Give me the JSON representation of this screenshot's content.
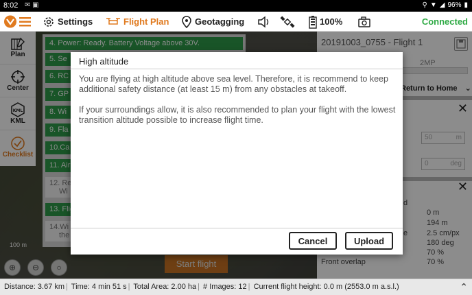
{
  "status_bar": {
    "time": "8:02",
    "battery": "96%"
  },
  "toolbar": {
    "settings_label": "Settings",
    "flight_plan_label": "Flight Plan",
    "geotagging_label": "Geotagging",
    "battery_label": "100%",
    "connection_status": "Connected",
    "accent_color": "#e07a1f",
    "connected_color": "#2eaa44"
  },
  "left_panel": {
    "items": [
      {
        "label": "Plan",
        "icon": "plan-icon"
      },
      {
        "label": "Center",
        "icon": "crosshair-icon"
      },
      {
        "label": "KML",
        "icon": "kml-icon"
      },
      {
        "label": "Checklist",
        "icon": "check-circle-icon"
      }
    ]
  },
  "checklist": {
    "items": [
      "4. Power: Ready. Battery Voltage above 30V.",
      "5. Se",
      "6. RC",
      "7. GP",
      "8. Wi",
      "9. Fla",
      "10.Ca",
      "11. Air",
      "12. Re",
      "13. Flig",
      "14.Wi"
    ],
    "gray_sublines": {
      "12": "Wi",
      "14": "the"
    }
  },
  "right_panel": {
    "title": "20191003_0755 - Flight 1",
    "camera": "2MP",
    "progress": "0%",
    "return_mode": "Return to Home",
    "input1_value": "50",
    "input1_unit": "m",
    "input2_value": "0",
    "input2_unit": "deg",
    "field_cut": "d",
    "values": [
      {
        "label": "",
        "value": "0 m"
      },
      {
        "label": "",
        "value": "194 m"
      },
      {
        "label": "e",
        "value": "2.5 cm/px"
      },
      {
        "label": "",
        "value": "180 deg"
      },
      {
        "label": "",
        "value": "70 %"
      },
      {
        "label": "Front overlap",
        "value": "70 %"
      }
    ]
  },
  "map": {
    "start_flight_label": "Start flight",
    "scale_label": "100 m"
  },
  "bottom_bar": {
    "distance": "Distance: 3.67 km",
    "time": "Time: 4 min 51 s",
    "area": "Total Area: 2.00 ha",
    "images": "# Images: 12",
    "height": "Current flight height: 0.0 m (2553.0 m a.s.l.)"
  },
  "dialog": {
    "title": "High altitude",
    "paragraph1": "You are flying at high altitude above sea level. Therefore, it is recommend to keep additional safety distance (at least 15 m) from any obstacles at takeoff.",
    "paragraph2": "If your surroundings allow, it is also recommended to plan your flight with the lowest transition altitude possible to increase flight time.",
    "cancel_label": "Cancel",
    "upload_label": "Upload"
  }
}
